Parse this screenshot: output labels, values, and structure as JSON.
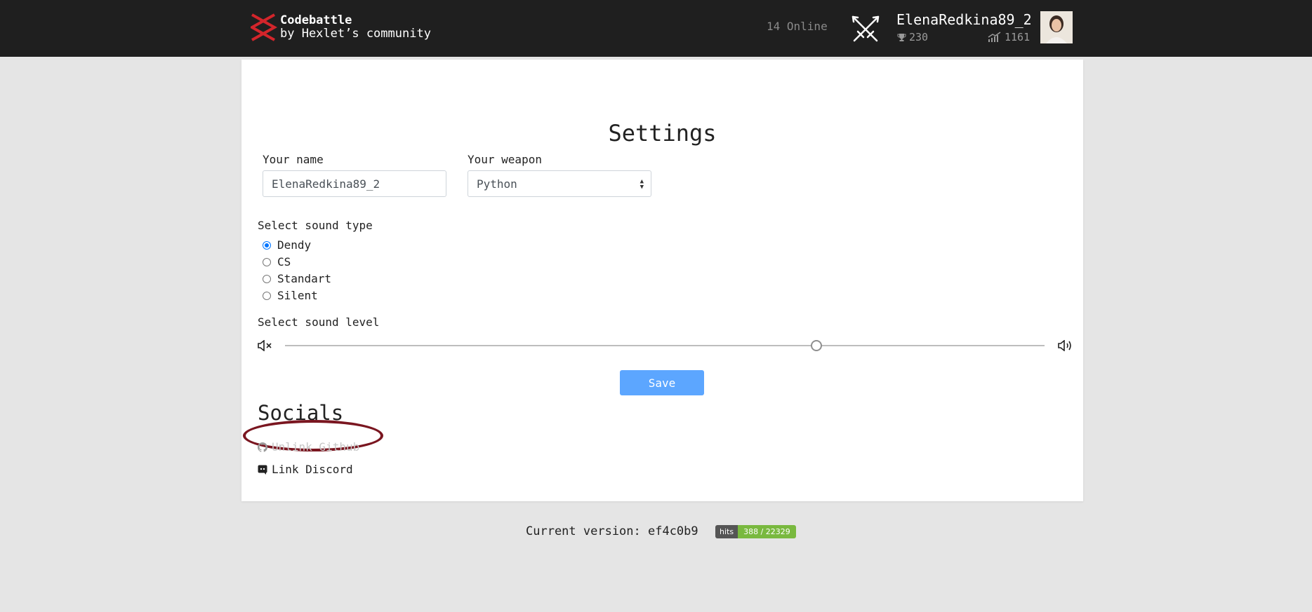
{
  "header": {
    "brand_title": "Codebattle",
    "brand_subtitle": "by Hexlet’s community",
    "online": "14 Online",
    "user": {
      "name": "ElenaRedkina89_2",
      "rank": "230",
      "rating": "1161"
    }
  },
  "settings": {
    "title": "Settings",
    "name_label": "Your name",
    "name_value": "ElenaRedkina89_2",
    "weapon_label": "Your weapon",
    "weapon_value": "Python",
    "sound_type_label": "Select sound type",
    "sound_types": [
      {
        "label": "Dendy",
        "checked": true
      },
      {
        "label": "CS",
        "checked": false
      },
      {
        "label": "Standart",
        "checked": false
      },
      {
        "label": "Silent",
        "checked": false
      }
    ],
    "sound_level_label": "Select sound level",
    "sound_level": 0.7,
    "save_label": "Save"
  },
  "socials": {
    "title": "Socials",
    "github_label": "Unlink Github",
    "discord_label": "Link Discord"
  },
  "footer": {
    "version": "Current version: ef4c0b9",
    "hits_label": "hits",
    "hits_value": "388 / 22329"
  },
  "colors": {
    "header_bg": "#1f1f1f",
    "page_bg": "#e5e5e5",
    "save_button": "#5ca6ff",
    "radio_accent": "#0075ff",
    "highlight_ellipse": "#7a1620",
    "hits_green": "#79b93f"
  }
}
